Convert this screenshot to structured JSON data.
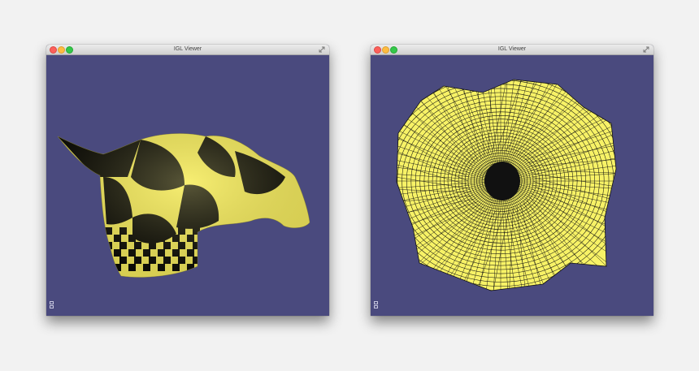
{
  "windows": [
    {
      "title": "IGL Viewer",
      "view": "textured-3d-mesh"
    },
    {
      "title": "IGL Viewer",
      "view": "wireframe-parameterization"
    }
  ],
  "colors": {
    "viewport_bg": "#4a4a7e",
    "mesh_yellow": "#f2ea5c",
    "checker_black": "#000000",
    "wire_line": "#111111"
  },
  "icons": [
    "close-icon",
    "minimize-icon",
    "zoom-icon",
    "resize-icon"
  ]
}
